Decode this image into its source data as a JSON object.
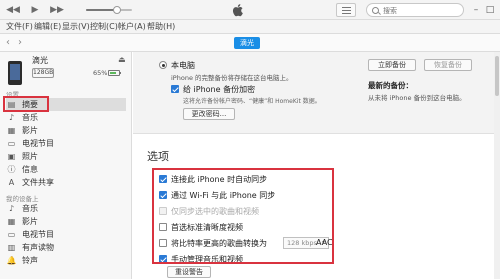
{
  "menu": {
    "items": [
      "文件(F)",
      "编辑(E)",
      "显示(V)",
      "控制(C)",
      "帐户(A)",
      "帮助(H)"
    ]
  },
  "search": {
    "placeholder": "搜索"
  },
  "nav": {
    "device_tab": "滴光"
  },
  "device": {
    "name": "滴光",
    "capacity": "128GB",
    "battery_percent": "65%",
    "battery_level": 0.65
  },
  "sidebar": {
    "settings_header": "设置",
    "settings_items": [
      {
        "label": "摘要",
        "icon": "summary-icon"
      },
      {
        "label": "音乐",
        "icon": "music-icon"
      },
      {
        "label": "影片",
        "icon": "movie-icon"
      },
      {
        "label": "电视节目",
        "icon": "tv-icon"
      },
      {
        "label": "照片",
        "icon": "photo-icon"
      },
      {
        "label": "信息",
        "icon": "info-icon"
      },
      {
        "label": "文件共享",
        "icon": "file-share-icon"
      }
    ],
    "ondevice_header": "我的设备上",
    "ondevice_items": [
      {
        "label": "音乐",
        "icon": "music-icon"
      },
      {
        "label": "影片",
        "icon": "movie-icon"
      },
      {
        "label": "电视节目",
        "icon": "tv-icon"
      },
      {
        "label": "有声读物",
        "icon": "audiobook-icon"
      },
      {
        "label": "铃声",
        "icon": "ringtone-icon"
      }
    ]
  },
  "backup": {
    "this_computer_label": "本电脑",
    "this_computer_desc": "iPhone 的完整备份将存储在这台电脑上。",
    "encrypt_label": "给 iPhone 备份加密",
    "encrypt_desc": "这将允许备份帐户密码、“健康”和 HomeKit 数据。",
    "change_password_button": "更改密码...",
    "backup_now_button": "立即备份",
    "restore_button": "恢复备份",
    "latest_backup_label": "最新的备份：",
    "latest_backup_value": "从未将 iPhone 备份到这台电脑。"
  },
  "options": {
    "title": "选项",
    "items": [
      {
        "label": "连接此 iPhone 时自动同步",
        "checked": true,
        "disabled": false
      },
      {
        "label": "通过 Wi-Fi 与此 iPhone 同步",
        "checked": true,
        "disabled": false
      },
      {
        "label": "仅同步选中的歌曲和视频",
        "checked": false,
        "disabled": true
      },
      {
        "label": "首选标准清晰度视频",
        "checked": false,
        "disabled": false
      },
      {
        "label": "将比特率更高的歌曲转换为",
        "checked": false,
        "disabled": false
      },
      {
        "label": "手动管理音乐和视频",
        "checked": true,
        "disabled": false
      }
    ],
    "bitrate_value": "128 kbps",
    "bitrate_format": "AAC",
    "reset_warnings_button": "重设警告"
  },
  "colors": {
    "accent": "#1a8ee6",
    "highlight_box": "#d9333f",
    "checkbox_on": "#2a7ad5"
  }
}
